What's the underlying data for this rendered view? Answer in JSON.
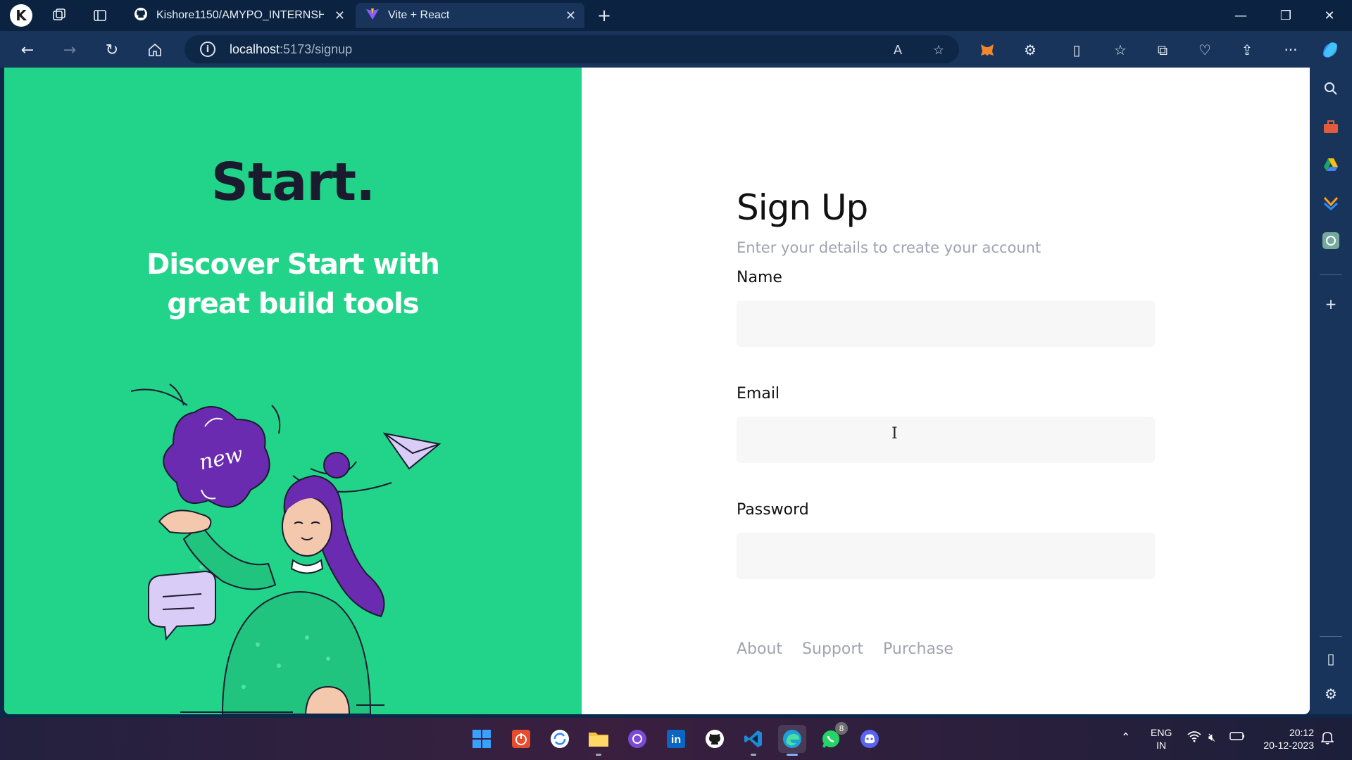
{
  "browser": {
    "tabs": [
      {
        "label": "Kishore1150/AMYPO_INTERNSHI",
        "icon": "github-icon"
      },
      {
        "label": "Vite + React",
        "icon": "vite-icon"
      }
    ],
    "address": {
      "host": "localhost",
      "path": ":5173/signup"
    }
  },
  "hero": {
    "brand": "Start.",
    "tagline": "Discover Start with great build tools",
    "badge": "new"
  },
  "form": {
    "title": "Sign Up",
    "subtitle": "Enter your details to create your account",
    "fields": [
      {
        "label": "Name",
        "value": ""
      },
      {
        "label": "Email",
        "value": ""
      },
      {
        "label": "Password",
        "value": ""
      }
    ]
  },
  "footer": {
    "links": [
      "About",
      "Support",
      "Purchase"
    ]
  },
  "taskbar": {
    "language": "ENG",
    "region": "IN",
    "time": "20:12",
    "date": "20-12-2023",
    "whatsapp_badge": "8"
  },
  "colors": {
    "hero_bg": "#22d48a",
    "accent_purple": "#6a2bb0",
    "muted_text": "#9ea3b0"
  }
}
